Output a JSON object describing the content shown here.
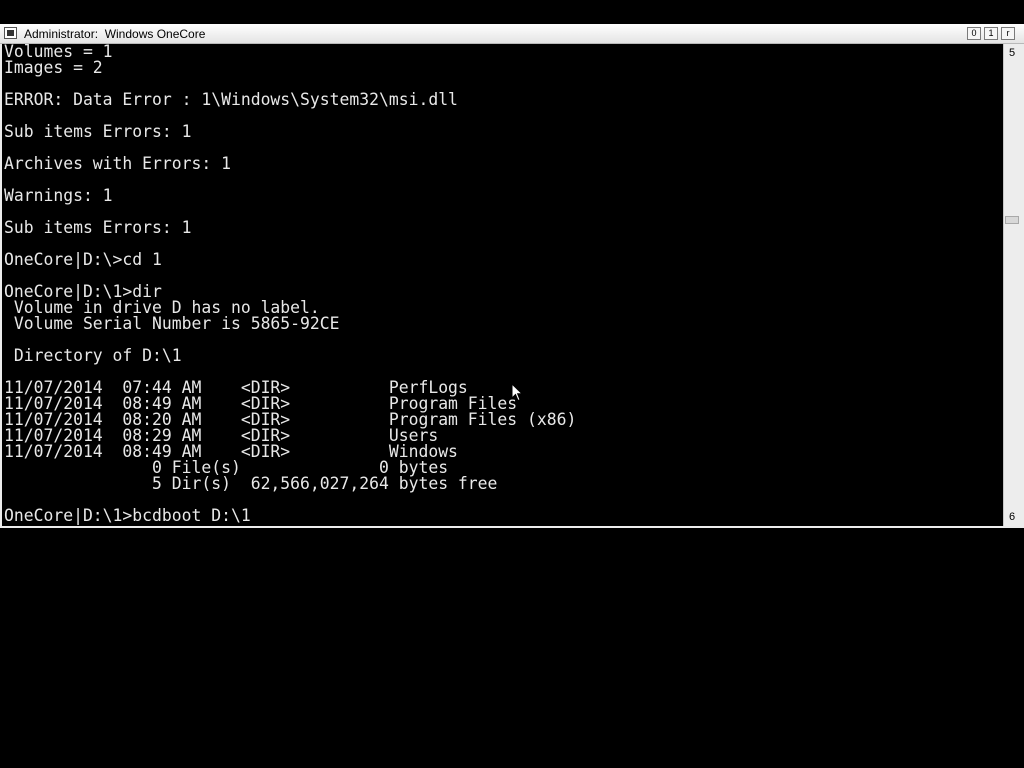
{
  "window": {
    "title": "Administrator:  Windows OneCore",
    "controls": {
      "minimize": "0",
      "maximize": "1",
      "close": "r"
    }
  },
  "scrollbar": {
    "up_glyph": "5",
    "down_glyph": "6"
  },
  "console": {
    "lines": [
      "Volumes = 1",
      "Images = 2",
      "",
      "ERROR: Data Error : 1\\Windows\\System32\\msi.dll",
      "",
      "Sub items Errors: 1",
      "",
      "Archives with Errors: 1",
      "",
      "Warnings: 1",
      "",
      "Sub items Errors: 1",
      "",
      "OneCore|D:\\>cd 1",
      "",
      "OneCore|D:\\1>dir",
      " Volume in drive D has no label.",
      " Volume Serial Number is 5865-92CE",
      "",
      " Directory of D:\\1",
      "",
      "11/07/2014  07:44 AM    <DIR>          PerfLogs",
      "11/07/2014  08:49 AM    <DIR>          Program Files",
      "11/07/2014  08:20 AM    <DIR>          Program Files (x86)",
      "11/07/2014  08:29 AM    <DIR>          Users",
      "11/07/2014  08:49 AM    <DIR>          Windows",
      "               0 File(s)              0 bytes",
      "               5 Dir(s)  62,566,027,264 bytes free",
      "",
      "OneCore|D:\\1>bcdboot D:\\1"
    ]
  }
}
